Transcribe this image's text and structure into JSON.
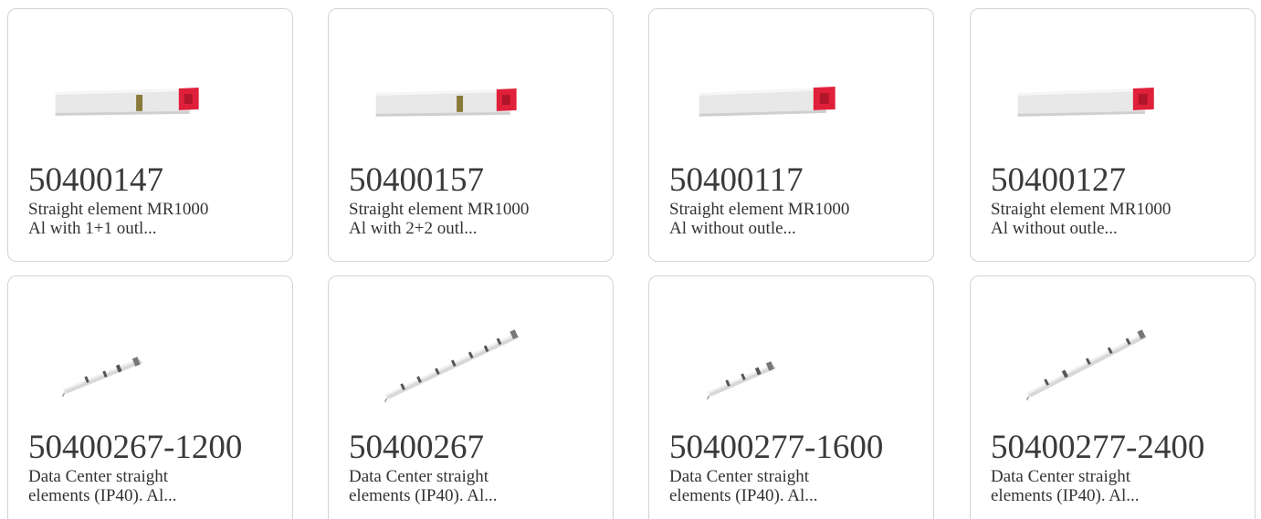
{
  "products": [
    {
      "code": "50400147",
      "line1": "Straight element MR1000",
      "line2": "Al with 1+1 outl..."
    },
    {
      "code": "50400157",
      "line1": "Straight element MR1000",
      "line2": "Al with 2+2 outl..."
    },
    {
      "code": "50400117",
      "line1": "Straight element MR1000",
      "line2": "Al without outle..."
    },
    {
      "code": "50400127",
      "line1": "Straight element MR1000",
      "line2": "Al without outle..."
    },
    {
      "code": "50400267-1200",
      "line1": "Data Center straight",
      "line2": "elements (IP40). Al..."
    },
    {
      "code": "50400267",
      "line1": "Data Center straight",
      "line2": "elements (IP40). Al..."
    },
    {
      "code": "50400277-1600",
      "line1": "Data Center straight",
      "line2": "elements (IP40). Al..."
    },
    {
      "code": "50400277-2400",
      "line1": "Data Center straight",
      "line2": "elements (IP40). Al..."
    }
  ],
  "colors": {
    "card_border": "#d4d4d4",
    "busbar_body": "#e6e6e6",
    "busbar_end_cap": "#e0203a",
    "outlet": "#8a7a3a"
  }
}
